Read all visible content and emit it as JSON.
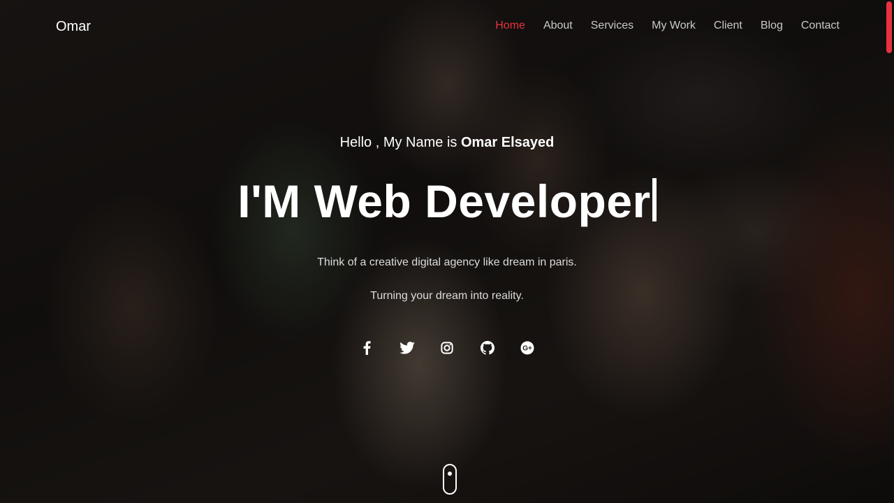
{
  "navbar": {
    "brand": "Omar",
    "links": [
      {
        "label": "Home",
        "active": true
      },
      {
        "label": "About",
        "active": false
      },
      {
        "label": "Services",
        "active": false
      },
      {
        "label": "My Work",
        "active": false
      },
      {
        "label": "Client",
        "active": false
      },
      {
        "label": "Blog",
        "active": false
      },
      {
        "label": "Contact",
        "active": false
      }
    ]
  },
  "hero": {
    "greeting_prefix": "Hello , My Name is",
    "greeting_name": "Omar Elsayed",
    "headline": "I'M Web Developer",
    "tagline_1": "Think of a creative digital agency like dream in paris.",
    "tagline_2": "Turning your dream into reality.",
    "socials": [
      {
        "icon": "facebook-icon"
      },
      {
        "icon": "twitter-icon"
      },
      {
        "icon": "instagram-icon"
      },
      {
        "icon": "github-icon"
      },
      {
        "icon": "google-plus-icon"
      }
    ]
  },
  "colors": {
    "accent": "#e8323e",
    "nav_text": "#c9c9c9",
    "text": "#ffffff"
  }
}
